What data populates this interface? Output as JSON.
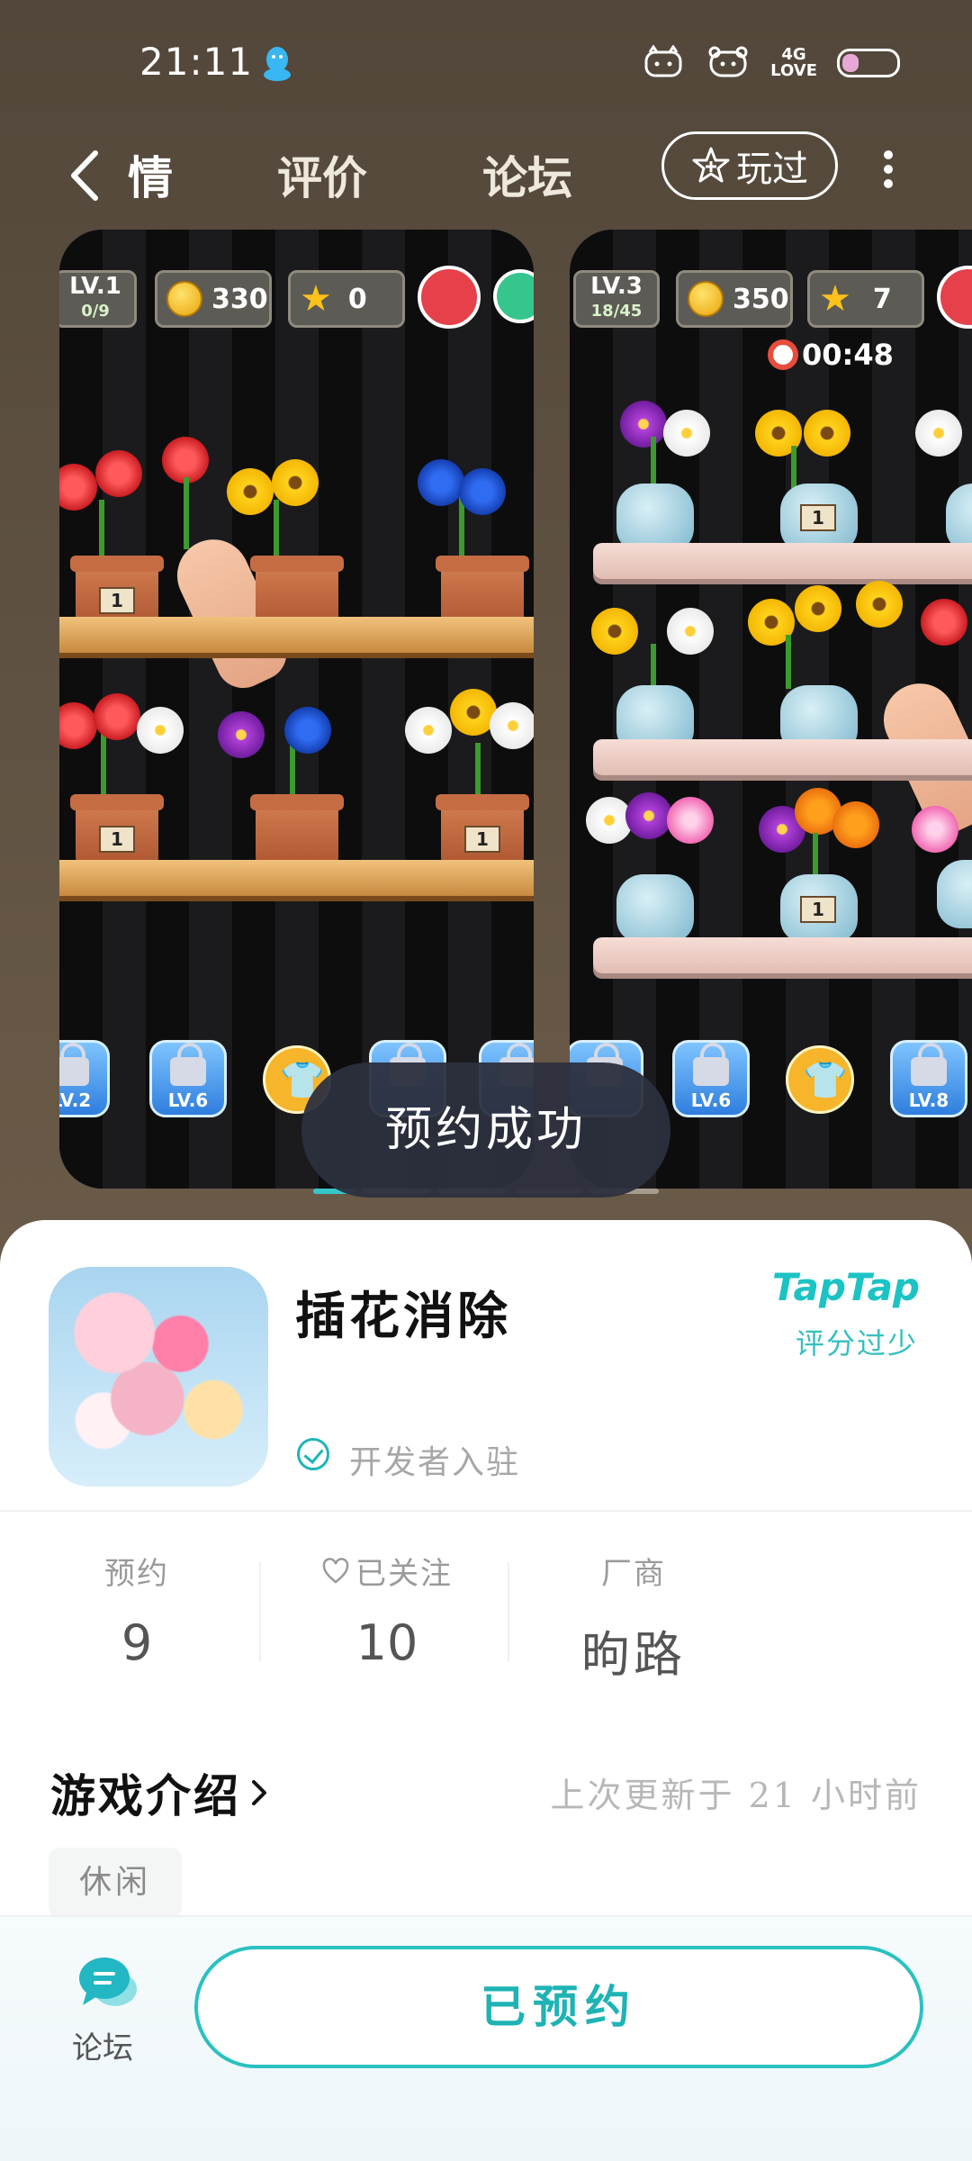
{
  "status_bar": {
    "time": "21:11",
    "network_label_top": "4G",
    "network_label_bottom": "LOVE"
  },
  "nav": {
    "tabs": [
      {
        "label": "情",
        "active": true
      },
      {
        "label": "评价",
        "active": false
      },
      {
        "label": "论坛",
        "active": false
      }
    ],
    "played_label": "玩过"
  },
  "screenshots": {
    "shot1": {
      "level": "LV.1",
      "progress": "0/9",
      "coins": "330",
      "stars": "0"
    },
    "shot2": {
      "level": "LV.3",
      "progress": "18/45",
      "coins": "350",
      "stars": "7",
      "timer": "00:48"
    },
    "pot_tag": "1",
    "locks": [
      "LV.2",
      "LV.6",
      "LV.6",
      "LV.8"
    ]
  },
  "toast": "预约成功",
  "app": {
    "name": "插花消除",
    "developer_badge": "开发者入驻",
    "platform_logo": "TapTap",
    "rating_note": "评分过少"
  },
  "stats": [
    {
      "label": "预约",
      "value": "9"
    },
    {
      "label": "已关注",
      "value": "10"
    },
    {
      "label": "厂商",
      "value": "昫路"
    }
  ],
  "intro": {
    "title": "游戏介绍",
    "updated": "上次更新于 21 小时前",
    "tags": [
      "休闲"
    ]
  },
  "bottom": {
    "forum_label": "论坛",
    "reserve_label": "已预约"
  },
  "colors": {
    "accent": "#1fb3b4",
    "toast_bg": "#2c303e"
  }
}
